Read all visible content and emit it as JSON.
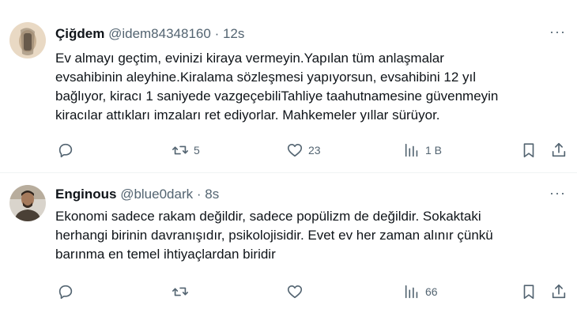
{
  "tweets": [
    {
      "name": "Çiğdem",
      "handle": "@idem84348160",
      "separator": "·",
      "time": "12s",
      "more": "···",
      "lines": [
        "Ev almayı geçtim, evinizi kiraya vermeyin.Yapılan tüm anlaşmalar",
        "evsahibinin aleyhine.Kiralama sözleşmesi yapıyorsun, evsahibini 12 yıl",
        "bağlıyor, kiracı 1 saniyede vazgeçebiliTahliye taahutnamesine güvenmeyin",
        "kiracılar attıkları imzaları ret ediyorlar. Mahkemeler yıllar sürüyor."
      ],
      "retweets": "5",
      "likes": "23",
      "views": "1 B"
    },
    {
      "name": "Enginous",
      "handle": "@blue0dark",
      "separator": "·",
      "time": "8s",
      "more": "···",
      "lines": [
        "Ekonomi sadece rakam değildir, sadece popülizm de değildir. Sokaktaki",
        "herhangi birinin davranışıdır, psikolojisidir. Evet ev her zaman alınır çünkü",
        "barınma en temel ihtiyaçlardan biridir"
      ],
      "retweets": "",
      "likes": "",
      "views": "66"
    }
  ],
  "icons": {
    "reply": "reply-icon",
    "retweet": "retweet-icon",
    "like": "heart-icon",
    "views": "views-icon",
    "bookmark": "bookmark-icon",
    "share": "share-icon"
  },
  "colors": {
    "text": "#0f1419",
    "secondary": "#536471",
    "divider": "#eff3f4"
  }
}
